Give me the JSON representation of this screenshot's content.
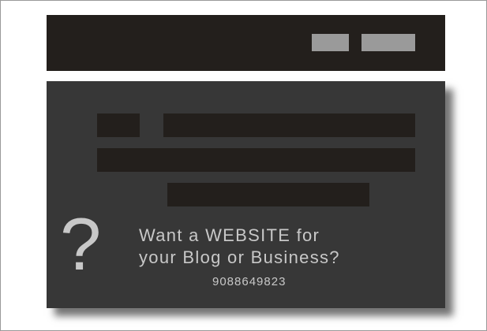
{
  "promo": {
    "question_glyph": "?",
    "headline_line1": "Want a WEBSITE for",
    "headline_line2": "your Blog or Business?",
    "phone": "9088649823"
  },
  "colors": {
    "background": "#ffffff",
    "dark_bar": "#231f1c",
    "panel": "#373737",
    "placeholder_button": "#9a9a9a",
    "text": "#c8c8c8"
  }
}
